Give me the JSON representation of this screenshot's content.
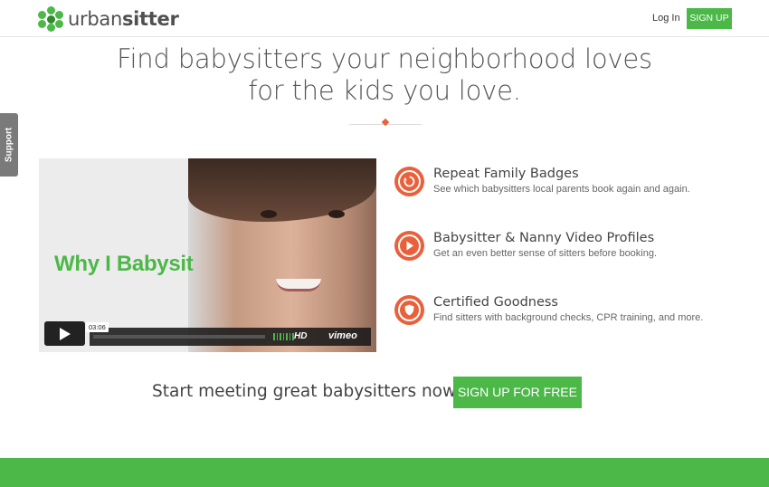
{
  "brand": {
    "name_light": "urban",
    "name_bold": "sitter",
    "color": "#4cb848",
    "accent": "#e8613c"
  },
  "header": {
    "login_label": "Log In",
    "signup_label": "SIGN UP"
  },
  "support_tab": {
    "label": "Support"
  },
  "hero": {
    "title_line1": "Find babysitters your neighborhood loves",
    "title_line2": "for the kids you love."
  },
  "video": {
    "caption": "Why I Babysit",
    "timecode": "03:06",
    "hd_label": "HD",
    "provider_label": "vimeo",
    "play_icon": "play-icon"
  },
  "features": [
    {
      "icon": "repeat-badge-icon",
      "title": "Repeat Family Badges",
      "description": "See which babysitters local parents book again and again."
    },
    {
      "icon": "video-play-icon",
      "title": "Babysitter & Nanny Video Profiles",
      "description": "Get an even better sense of sitters before booking."
    },
    {
      "icon": "shield-icon",
      "title": "Certified Goodness",
      "description": "Find sitters with background checks, CPR training, and more."
    }
  ],
  "cta": {
    "text": "Start meeting great babysitters now.",
    "button_label": "SIGN UP FOR FREE"
  }
}
